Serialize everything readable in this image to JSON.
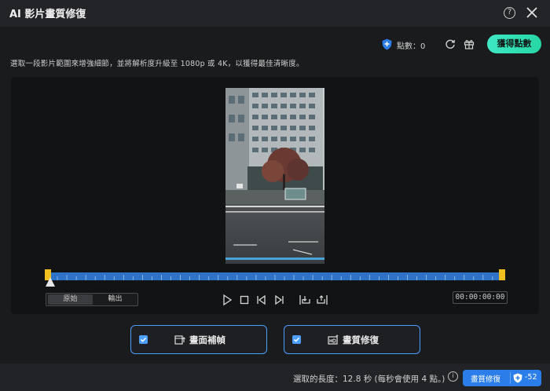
{
  "window": {
    "title": "AI 影片畫質修復",
    "help_label": "?"
  },
  "topbar": {
    "points_label": "點數：0",
    "get_points_button": "獲得點數"
  },
  "description": "選取一段影片範圍來增強細節，並將解析度升級至 1080p 或 4K，以獲得最佳清晰度。",
  "preview_toggle": {
    "original": "原始",
    "output": "輸出",
    "active": "original"
  },
  "player": {
    "timecode": "00:00:00:00"
  },
  "features": [
    {
      "label": "畫面補幀",
      "checked": true,
      "icon": "frame-interpolation-icon"
    },
    {
      "label": "畫質修復",
      "checked": true,
      "icon": "hd-enhance-icon"
    }
  ],
  "bottombar": {
    "selected_length": "選取的長度：12.8 秒 (每秒會使用 4 點。)",
    "info_label": "i",
    "enhance_button": "畫質修復",
    "enhance_cost": "-52"
  },
  "colors": {
    "accent_blue": "#2b7de9",
    "outline_blue": "#4c9eff",
    "points_green": "#3ee8c3",
    "trim_handle": "#f0c020"
  }
}
